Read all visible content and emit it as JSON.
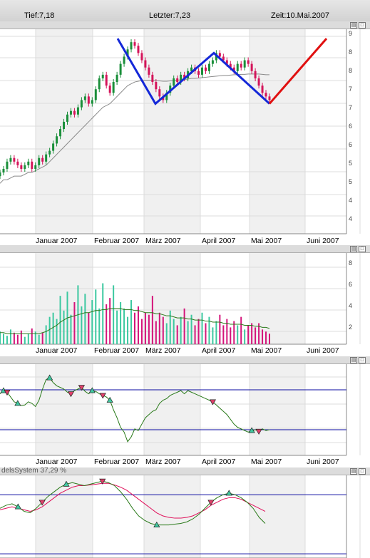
{
  "header": {
    "low_label": "Tief:7,18",
    "last_label": "Letzter:7,23",
    "time_label": "Zeit:10.Mai.2007"
  },
  "window_buttons": [
    "▤",
    "□"
  ],
  "colors": {
    "up_candle": "#1a8f3a",
    "down_candle": "#d4145a",
    "trend_blue": "#1428d8",
    "projection_red": "#e01010",
    "band_shade": "#f0f0f0",
    "volume_up": "#3cc8a0",
    "volume_down": "#d4147a",
    "indicator_line": "#2a7a1a",
    "signal_line": "#e0105a",
    "threshold_line": "#0a0aa0"
  },
  "chart_data": [
    {
      "type": "candlestick",
      "name": "price",
      "x_axis": [
        "Januar 2007",
        "Februar 2007",
        "März 2007",
        "April 2007",
        "Mai 2007",
        "Juni 2007"
      ],
      "right_tick_labels": [
        "9",
        "8",
        "8",
        "7",
        "7",
        "6",
        "6",
        "5",
        "5",
        "4",
        "4"
      ],
      "ylim": [
        4,
        9
      ],
      "close": [
        5.2,
        5.3,
        5.5,
        5.6,
        5.5,
        5.4,
        5.3,
        5.4,
        5.5,
        5.3,
        5.4,
        5.6,
        5.5,
        5.7,
        5.8,
        6.0,
        6.2,
        6.4,
        6.6,
        6.8,
        6.9,
        6.8,
        7.0,
        7.2,
        7.3,
        7.1,
        7.2,
        7.5,
        7.8,
        7.9,
        7.6,
        7.4,
        7.7,
        7.9,
        8.2,
        8.4,
        8.6,
        8.8,
        8.7,
        8.5,
        8.3,
        8.1,
        7.9,
        7.7,
        7.5,
        7.3,
        7.2,
        7.4,
        7.6,
        7.8,
        7.7,
        7.9,
        7.8,
        8.0,
        8.1,
        8.0,
        7.9,
        8.1,
        8.0,
        8.2,
        8.3,
        8.5,
        8.4,
        8.3,
        8.2,
        8.1,
        8.0,
        8.2,
        8.1,
        8.3,
        8.2,
        8.0,
        7.8,
        7.6,
        7.4,
        7.3,
        7.2
      ],
      "moving_average": [
        4.9,
        5.0,
        5.0,
        5.05,
        5.1,
        5.1,
        5.1,
        5.15,
        5.2,
        5.2,
        5.25,
        5.3,
        5.35,
        5.4,
        5.5,
        5.6,
        5.7,
        5.8,
        5.9,
        6.0,
        6.1,
        6.2,
        6.3,
        6.4,
        6.5,
        6.6,
        6.7,
        6.8,
        6.9,
        7.0,
        7.05,
        7.1,
        7.2,
        7.3,
        7.4,
        7.5,
        7.6,
        7.65,
        7.7,
        7.72,
        7.74,
        7.75,
        7.75,
        7.75,
        7.74,
        7.73,
        7.72,
        7.72,
        7.73,
        7.74,
        7.75,
        7.76,
        7.77,
        7.78,
        7.8,
        7.8,
        7.81,
        7.82,
        7.83,
        7.84,
        7.85,
        7.86,
        7.87,
        7.88,
        7.88,
        7.89,
        7.9,
        7.9,
        7.91,
        7.91,
        7.92,
        7.92,
        7.92,
        7.92,
        7.91,
        7.9,
        7.9
      ],
      "trend_lines": {
        "blue": [
          [
            "Feb 07",
            8.9
          ],
          [
            "Mär 07",
            7.1
          ],
          [
            "Apr 07",
            8.5
          ],
          [
            "Mai 10",
            7.1
          ]
        ],
        "red": [
          [
            "Mai 10",
            7.1
          ],
          [
            "Jun 07",
            8.9
          ]
        ]
      }
    },
    {
      "type": "bar",
      "name": "volume",
      "x_axis": [
        "Januar 2007",
        "Februar 2007",
        "März 2007",
        "April 2007",
        "Mai 2007",
        "Juni 2007"
      ],
      "right_tick_labels": [
        "8",
        "6",
        "4",
        "2"
      ],
      "ylim": [
        0,
        8
      ],
      "values": [
        1.2,
        1.0,
        0.8,
        1.4,
        1.1,
        0.9,
        1.3,
        0.7,
        1.0,
        1.5,
        1.2,
        0.9,
        1.1,
        1.8,
        2.6,
        3.0,
        2.4,
        4.6,
        3.2,
        5.0,
        2.8,
        4.0,
        5.6,
        3.6,
        4.8,
        3.0,
        4.2,
        5.2,
        3.4,
        5.8,
        3.8,
        4.4,
        5.6,
        3.2,
        4.0,
        3.4,
        2.6,
        4.2,
        3.0,
        3.6,
        2.4,
        3.0,
        2.8,
        4.6,
        2.2,
        3.0,
        2.6,
        2.0,
        3.2,
        2.4,
        1.8,
        2.6,
        3.4,
        2.2,
        2.8,
        1.8,
        2.4,
        3.0,
        2.0,
        2.6,
        1.6,
        2.2,
        2.8,
        1.8,
        2.4,
        1.6,
        2.2,
        1.8,
        2.6,
        1.4,
        1.8,
        2.0,
        1.6,
        2.0,
        1.4,
        1.2,
        1.0
      ],
      "moving_average": [
        1.1,
        1.1,
        1.0,
        1.0,
        1.0,
        1.0,
        1.0,
        1.0,
        1.0,
        1.0,
        1.0,
        1.0,
        1.1,
        1.2,
        1.4,
        1.6,
        1.8,
        2.1,
        2.3,
        2.5,
        2.6,
        2.7,
        2.8,
        2.9,
        3.0,
        3.0,
        3.1,
        3.2,
        3.2,
        3.3,
        3.3,
        3.4,
        3.4,
        3.4,
        3.4,
        3.3,
        3.3,
        3.3,
        3.2,
        3.2,
        3.1,
        3.0,
        3.0,
        3.0,
        2.9,
        2.9,
        2.8,
        2.7,
        2.7,
        2.6,
        2.5,
        2.5,
        2.5,
        2.4,
        2.4,
        2.3,
        2.3,
        2.3,
        2.2,
        2.2,
        2.1,
        2.1,
        2.1,
        2.0,
        2.0,
        1.9,
        1.9,
        1.9,
        1.9,
        1.8,
        1.8,
        1.8,
        1.7,
        1.7,
        1.6,
        1.6,
        1.5
      ]
    },
    {
      "type": "line",
      "name": "oscillator",
      "x_axis": [
        "Januar 2007",
        "Februar 2007",
        "März 2007",
        "April 2007",
        "Mai 2007",
        "Juni 2007"
      ],
      "ylim": [
        0,
        100
      ],
      "upper_band": 75,
      "lower_band": 25,
      "values": [
        70,
        74,
        72,
        66,
        60,
        58,
        55,
        56,
        60,
        58,
        54,
        62,
        76,
        88,
        90,
        84,
        80,
        78,
        76,
        72,
        70,
        74,
        76,
        78,
        73,
        70,
        74,
        73,
        70,
        68,
        66,
        62,
        50,
        40,
        28,
        22,
        10,
        16,
        26,
        24,
        32,
        40,
        44,
        48,
        50,
        58,
        62,
        64,
        68,
        70,
        72,
        74,
        70,
        74,
        72,
        70,
        68,
        66,
        64,
        62,
        60,
        56,
        52,
        48,
        44,
        38,
        32,
        28,
        26,
        24,
        22,
        24,
        25,
        23,
        26,
        24,
        25
      ],
      "buy_markers": [
        1,
        5,
        14,
        26,
        31,
        71
      ],
      "sell_markers": [
        2,
        20,
        23,
        29,
        60,
        73
      ]
    },
    {
      "type": "line",
      "name": "handelssystem",
      "title": "delsSystem 37,29 %",
      "x_axis": [
        "Januar 2007",
        "Februar 2007",
        "März 2007",
        "April 2007",
        "Mai 2007",
        "Juni 2007"
      ],
      "ylim": [
        0,
        100
      ],
      "upper_band": 80,
      "lower_band": 15,
      "series": [
        {
          "values": [
            62,
            66,
            68,
            64,
            58,
            56,
            62,
            70,
            78,
            84,
            90,
            94,
            96,
            94,
            92,
            94,
            96,
            98,
            96,
            92,
            84,
            74,
            62,
            52,
            46,
            42,
            40,
            40,
            40,
            41,
            42,
            44,
            48,
            54,
            62,
            70,
            76,
            80,
            82,
            80,
            76,
            70,
            62,
            50,
            42
          ]
        },
        {
          "values": [
            60,
            62,
            64,
            62,
            60,
            58,
            60,
            64,
            70,
            76,
            82,
            86,
            90,
            92,
            92,
            93,
            94,
            95,
            95,
            93,
            90,
            86,
            80,
            74,
            68,
            62,
            56,
            52,
            50,
            49,
            49,
            50,
            52,
            56,
            60,
            66,
            70,
            74,
            76,
            76,
            74,
            70,
            66,
            62,
            58
          ]
        }
      ],
      "buy_markers": [
        3,
        11,
        26,
        38
      ],
      "sell_markers": [
        7,
        17,
        35
      ]
    }
  ]
}
